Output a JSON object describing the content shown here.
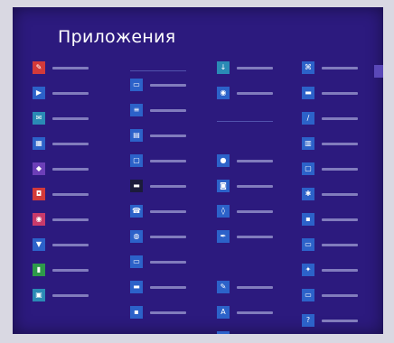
{
  "screen": {
    "title": "Приложения",
    "colors": {
      "background": "#2c1a7e",
      "tile_blue": "#2c62c9",
      "tile_red": "#d33a3a",
      "tile_pink": "#c93a6a",
      "tile_purple": "#6c3fb8",
      "tile_green": "#2e9a4a",
      "tile_teal": "#2a8ab5",
      "tile_dark": "#1b1b3a",
      "header_text": "#8d9ae0"
    }
  },
  "columns": [
    {
      "header": "",
      "items": [
        {
          "label": "",
          "icon": "paint-icon",
          "color": "#d33a3a"
        },
        {
          "label": "",
          "icon": "play-icon",
          "color": "#2c62c9"
        },
        {
          "label": "",
          "icon": "mail-icon",
          "color": "#2a8ab5"
        },
        {
          "label": "",
          "icon": "film-icon",
          "color": "#2c62c9"
        },
        {
          "label": "",
          "icon": "gamepad-icon",
          "color": "#6c3fb8"
        },
        {
          "label": "",
          "icon": "shopping-bag-icon",
          "color": "#d33a3a"
        },
        {
          "label": "",
          "icon": "chat-icon",
          "color": "#c93a6a"
        },
        {
          "label": "",
          "icon": "trophy-icon",
          "color": "#2c62c9"
        },
        {
          "label": "",
          "icon": "chart-icon",
          "color": "#2e9a4a"
        },
        {
          "label": "",
          "icon": "photo-icon",
          "color": "#2a8ab5"
        }
      ]
    },
    {
      "header": "",
      "items": [
        {
          "label": "",
          "icon": "window-icon",
          "color": "#2c62c9"
        },
        {
          "label": "",
          "icon": "document-icon",
          "color": "#2c62c9"
        },
        {
          "label": "",
          "icon": "note-icon",
          "color": "#2c62c9"
        },
        {
          "label": "",
          "icon": "monitor-icon",
          "color": "#2c62c9"
        },
        {
          "label": "",
          "icon": "terminal-icon",
          "color": "#1b1b3a"
        },
        {
          "label": "",
          "icon": "phone-icon",
          "color": "#2c62c9"
        },
        {
          "label": "",
          "icon": "globe-icon",
          "color": "#2c62c9"
        },
        {
          "label": "",
          "icon": "window-icon",
          "color": "#2c62c9"
        },
        {
          "label": "",
          "icon": "folder-icon",
          "color": "#2c62c9"
        },
        {
          "label": "",
          "icon": "app-icon",
          "color": "#2c62c9"
        }
      ]
    },
    {
      "header": "",
      "items": [
        {
          "label": "",
          "icon": "download-icon",
          "color": "#2a8ab5"
        },
        {
          "label": "",
          "icon": "chat-icon",
          "color": "#2c62c9"
        },
        {
          "label": "",
          "icon": "spacer",
          "color": "#2c1a7e"
        },
        {
          "label": "",
          "icon": "person-icon",
          "color": "#2c62c9"
        },
        {
          "label": "",
          "icon": "camera-icon",
          "color": "#2c62c9"
        },
        {
          "label": "",
          "icon": "speaker-icon",
          "color": "#2c62c9"
        },
        {
          "label": "",
          "icon": "pen-icon",
          "color": "#2c62c9"
        },
        {
          "label": "",
          "icon": "spacer",
          "color": "#2c1a7e"
        },
        {
          "label": "",
          "icon": "paint-icon",
          "color": "#2c62c9"
        },
        {
          "label": "",
          "icon": "text-icon",
          "color": "#2c62c9"
        },
        {
          "label": "",
          "icon": "grid-icon",
          "color": "#2c62c9"
        }
      ]
    },
    {
      "header": "",
      "items": [
        {
          "label": "",
          "icon": "network-icon",
          "color": "#2c62c9"
        },
        {
          "label": "",
          "icon": "folder-icon",
          "color": "#2c62c9"
        },
        {
          "label": "",
          "icon": "wand-icon",
          "color": "#2c62c9"
        },
        {
          "label": "",
          "icon": "calculator-icon",
          "color": "#2c62c9"
        },
        {
          "label": "",
          "icon": "monitor-icon",
          "color": "#2c62c9"
        },
        {
          "label": "",
          "icon": "settings-icon",
          "color": "#2c62c9"
        },
        {
          "label": "",
          "icon": "app-icon",
          "color": "#2c62c9"
        },
        {
          "label": "",
          "icon": "window-icon",
          "color": "#2c62c9"
        },
        {
          "label": "",
          "icon": "tools-icon",
          "color": "#2c62c9"
        },
        {
          "label": "",
          "icon": "window-icon",
          "color": "#2c62c9"
        },
        {
          "label": "",
          "icon": "help-icon",
          "color": "#2c62c9"
        }
      ]
    }
  ],
  "header_positions": [
    null,
    0,
    2,
    null
  ]
}
